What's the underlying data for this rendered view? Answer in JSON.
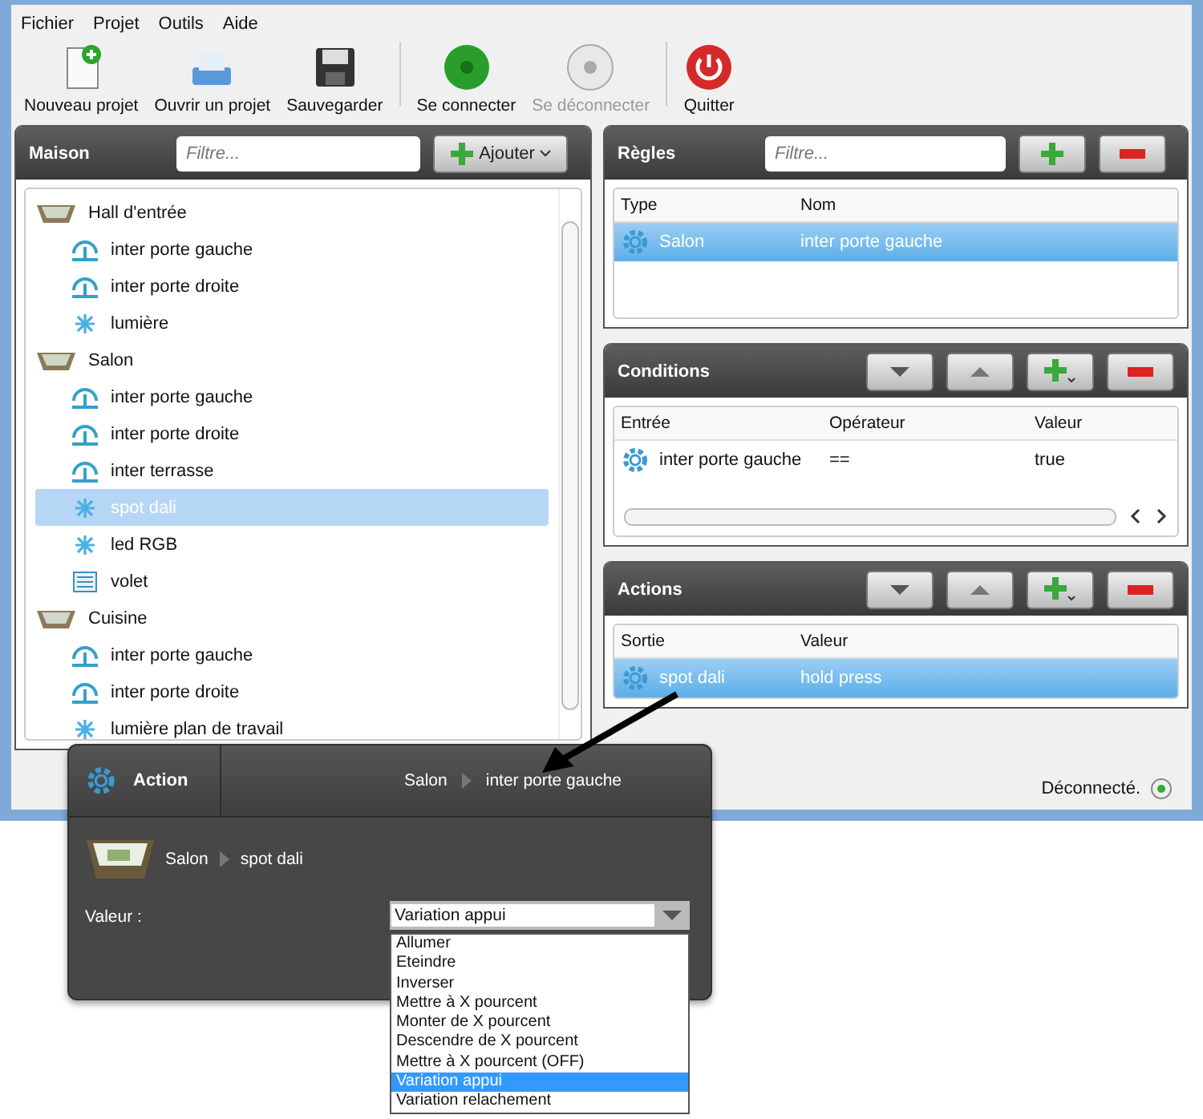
{
  "menu": [
    "Fichier",
    "Projet",
    "Outils",
    "Aide"
  ],
  "toolbar": [
    {
      "label": "Nouveau projet",
      "disabled": false
    },
    {
      "label": "Ouvrir un projet",
      "disabled": false
    },
    {
      "label": "Sauvegarder",
      "disabled": false
    },
    {
      "label": "Se connecter",
      "disabled": false
    },
    {
      "label": "Se déconnecter",
      "disabled": true
    },
    {
      "label": "Quitter",
      "disabled": false
    }
  ],
  "house": {
    "title": "Maison",
    "filter_placeholder": "Filtre...",
    "add_button": "Ajouter",
    "tree": [
      {
        "label": "Hall d'entrée",
        "children": [
          {
            "label": "inter porte gauche",
            "kind": "switch",
            "selected": false
          },
          {
            "label": "inter porte droite",
            "kind": "switch",
            "selected": false
          },
          {
            "label": "lumière",
            "kind": "light",
            "selected": false
          }
        ]
      },
      {
        "label": "Salon",
        "children": [
          {
            "label": "inter porte gauche",
            "kind": "switch",
            "selected": false
          },
          {
            "label": "inter porte droite",
            "kind": "switch",
            "selected": false
          },
          {
            "label": "inter terrasse",
            "kind": "switch",
            "selected": false
          },
          {
            "label": "spot dali",
            "kind": "light",
            "selected": true
          },
          {
            "label": "led RGB",
            "kind": "light",
            "selected": false
          },
          {
            "label": "volet",
            "kind": "shutter",
            "selected": false
          }
        ]
      },
      {
        "label": "Cuisine",
        "children": [
          {
            "label": "inter porte gauche",
            "kind": "switch",
            "selected": false
          },
          {
            "label": "inter porte droite",
            "kind": "switch",
            "selected": false
          },
          {
            "label": "lumière plan de travail",
            "kind": "light",
            "selected": false
          }
        ]
      }
    ]
  },
  "rules": {
    "title": "Règles",
    "filter_placeholder": "Filtre...",
    "columns": [
      "Type",
      "Nom"
    ],
    "rows": [
      {
        "cells": [
          "Salon",
          "inter porte gauche"
        ],
        "selected": true
      }
    ]
  },
  "conditions": {
    "title": "Conditions",
    "columns": [
      "Entrée",
      "Opérateur",
      "Valeur"
    ],
    "rows": [
      {
        "cells": [
          "inter porte gauche",
          "==",
          "true"
        ],
        "selected": false
      }
    ]
  },
  "actions": {
    "title": "Actions",
    "columns": [
      "Sortie",
      "Valeur"
    ],
    "rows": [
      {
        "cells": [
          "spot dali",
          "hold press"
        ],
        "selected": true
      }
    ]
  },
  "status": "Déconnecté.",
  "popup": {
    "title": "Action",
    "breadcrumb": [
      "Salon",
      "inter porte gauche"
    ],
    "target": [
      "Salon",
      "spot dali"
    ],
    "value_label": "Valeur :",
    "value": "Variation appui",
    "options": [
      {
        "label": "Allumer",
        "selected": false
      },
      {
        "label": "Eteindre",
        "selected": false
      },
      {
        "label": "Inverser",
        "selected": false
      },
      {
        "label": "Mettre à X pourcent",
        "selected": false
      },
      {
        "label": "Monter de X pourcent",
        "selected": false
      },
      {
        "label": "Descendre de X pourcent",
        "selected": false
      },
      {
        "label": "Mettre à X pourcent (OFF)",
        "selected": false
      },
      {
        "label": "Variation appui",
        "selected": true
      },
      {
        "label": "Variation relachement",
        "selected": false
      }
    ]
  }
}
